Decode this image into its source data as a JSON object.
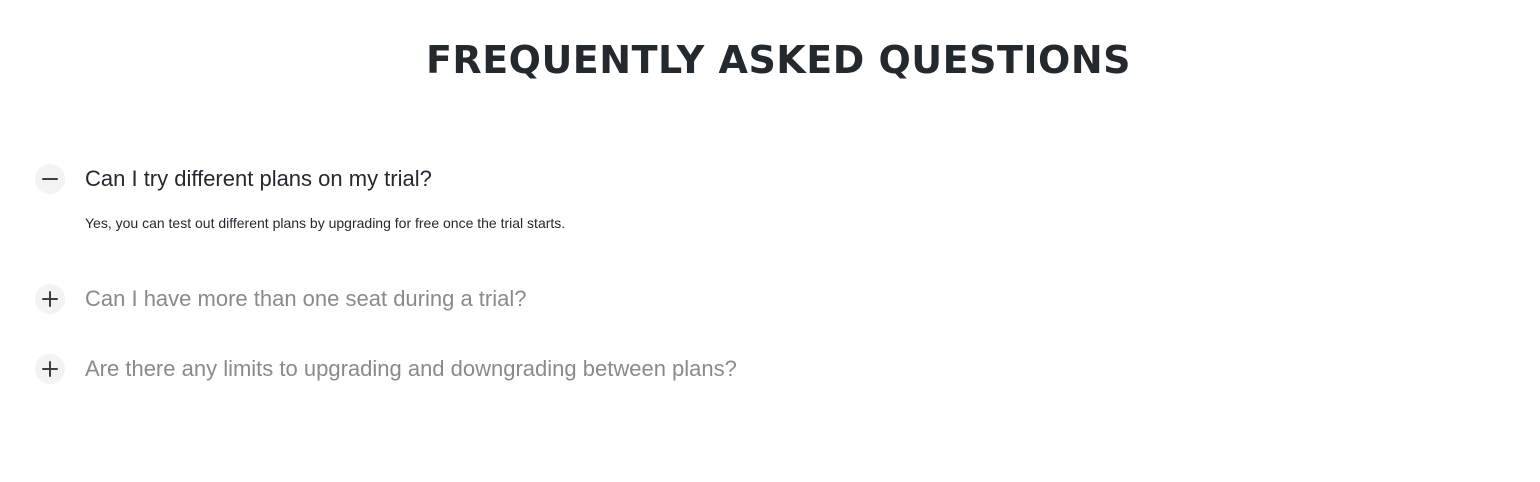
{
  "page": {
    "title": "FREQUENTLY ASKED QUESTIONS"
  },
  "faq": {
    "items": [
      {
        "question": "Can I try different plans on my trial?",
        "answer": "Yes, you can test out different plans by upgrading for free once the trial starts.",
        "expanded": true,
        "icon": "minus-icon"
      },
      {
        "question": "Can I have more than one seat during a trial?",
        "expanded": false,
        "icon": "plus-icon"
      },
      {
        "question": "Are there any limits to upgrading and downgrading between plans?",
        "expanded": false,
        "icon": "plus-icon"
      }
    ]
  },
  "colors": {
    "heading": "#24292e",
    "collapsed_question": "#8a8a8a",
    "icon_background": "#f3f3f3"
  }
}
